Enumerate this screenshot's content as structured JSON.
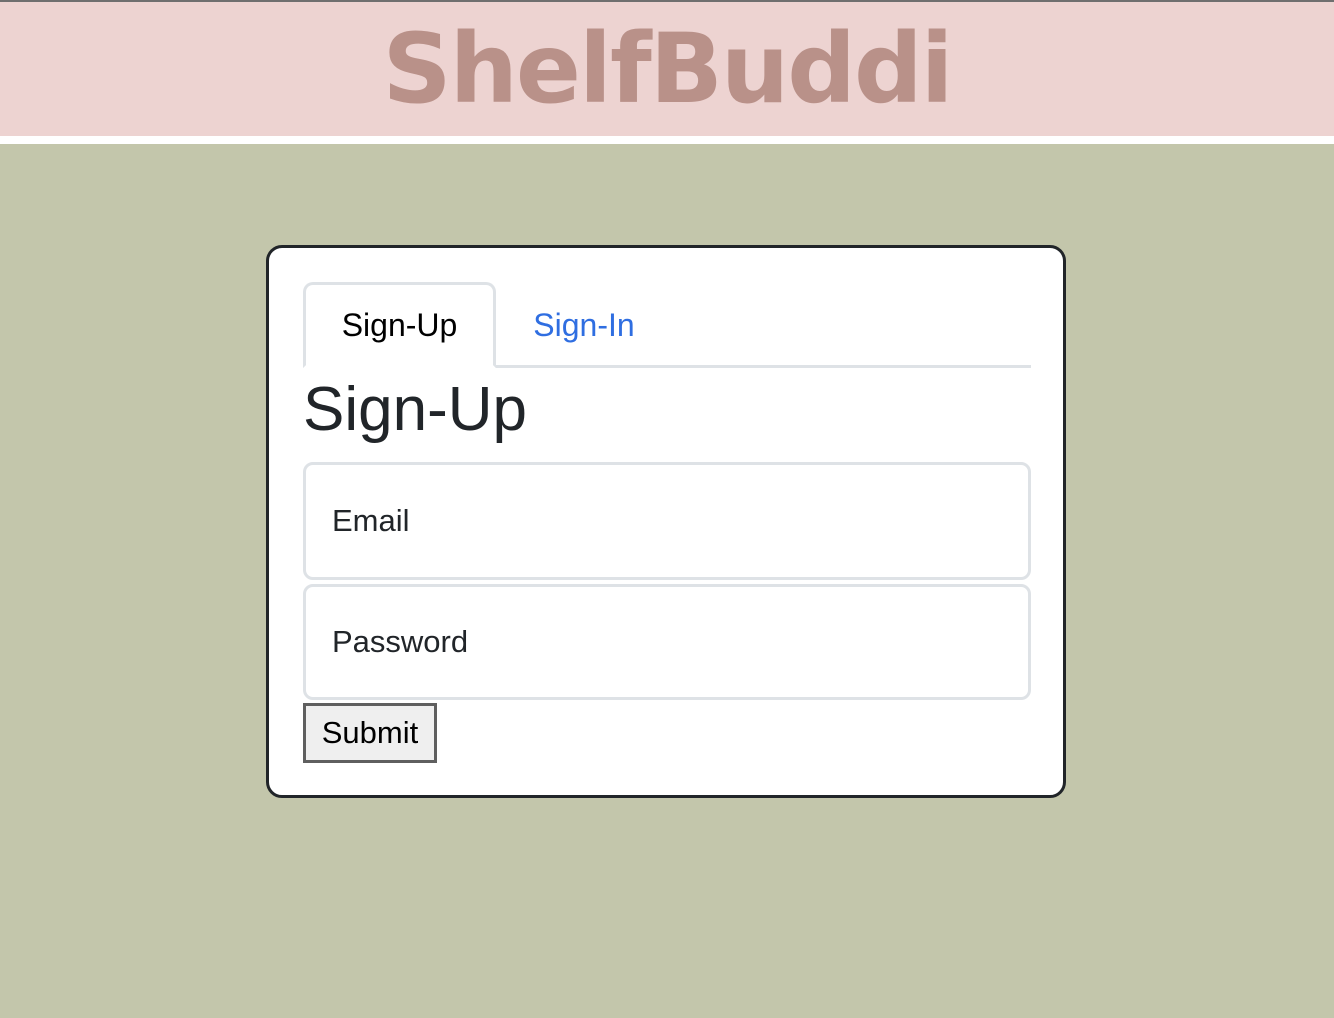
{
  "header": {
    "logo_text": "ShelfBuddi"
  },
  "colors": {
    "header_bg": "#edd3d1",
    "logo": "#b99189",
    "page_bg": "#c3c6ab",
    "link": "#2f6ee1"
  },
  "tabs": [
    {
      "label": "Sign-Up",
      "active": true
    },
    {
      "label": "Sign-In",
      "active": false
    }
  ],
  "form": {
    "title": "Sign-Up",
    "email_placeholder": "Email",
    "email_value": "",
    "password_placeholder": "Password",
    "password_value": "",
    "submit_label": "Submit"
  }
}
